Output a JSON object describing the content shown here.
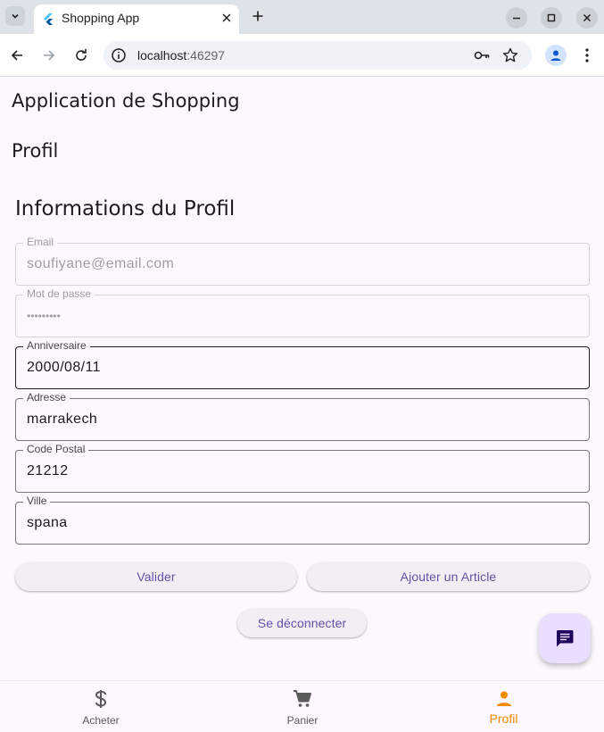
{
  "browser": {
    "tab_title": "Shopping App",
    "url_host": "localhost",
    "url_port": ":46297"
  },
  "app": {
    "title": "Application de Shopping",
    "page_title": "Profil",
    "section_title": "Informations du Profil"
  },
  "form": {
    "email": {
      "label": "Email",
      "value": "soufiyane@email.com"
    },
    "password": {
      "label": "Mot de passe",
      "value": "•••••••••"
    },
    "birthday": {
      "label": "Anniversaire",
      "value": "2000/08/11"
    },
    "address": {
      "label": "Adresse",
      "value": "marrakech"
    },
    "postal_code": {
      "label": "Code Postal",
      "value": "21212"
    },
    "city": {
      "label": "Ville",
      "value": "spana"
    }
  },
  "actions": {
    "validate_label": "Valider",
    "add_article_label": "Ajouter un Article",
    "logout_label": "Se déconnecter"
  },
  "bottom_nav": {
    "items": [
      {
        "label": "Acheter",
        "icon": "dollar-icon"
      },
      {
        "label": "Panier",
        "icon": "cart-icon"
      },
      {
        "label": "Profil",
        "icon": "person-icon",
        "active": true
      }
    ]
  },
  "colors": {
    "accent": "#6750a4",
    "active_nav": "#f38b00",
    "fab_bg": "#eaddff"
  }
}
